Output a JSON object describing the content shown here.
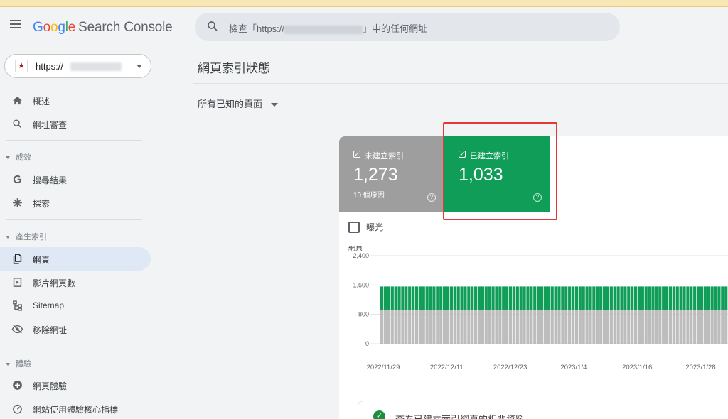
{
  "app": {
    "logo_letters": [
      "G",
      "o",
      "o",
      "g",
      "l",
      "e"
    ],
    "product": "Search Console",
    "search_prefix": "檢查「https://",
    "search_suffix": "」中的任何網址"
  },
  "property": {
    "label": "https://"
  },
  "sidebar": {
    "items_top": [
      {
        "label": "概述",
        "icon": "home-icon"
      },
      {
        "label": "網址審查",
        "icon": "search-icon"
      }
    ],
    "section_performance": "成效",
    "items_performance": [
      {
        "label": "搜尋結果",
        "icon": "google-g-icon"
      },
      {
        "label": "探索",
        "icon": "asterisk-icon"
      }
    ],
    "section_indexing": "產生索引",
    "items_indexing": [
      {
        "label": "網頁",
        "icon": "pages-icon",
        "active": true
      },
      {
        "label": "影片網頁數",
        "icon": "video-page-icon"
      },
      {
        "label": "Sitemap",
        "icon": "sitemap-icon"
      },
      {
        "label": "移除網址",
        "icon": "eye-off-icon"
      }
    ],
    "section_experience": "體驗",
    "items_experience": [
      {
        "label": "網頁體驗",
        "icon": "plus-circle-icon"
      },
      {
        "label": "網站使用體驗核心指標",
        "icon": "gauge-icon"
      }
    ]
  },
  "main": {
    "title": "網頁索引狀態",
    "filter": "所有已知的頁面",
    "tiles": [
      {
        "label": "未建立索引",
        "value": "1,273",
        "sub": "10 個原因",
        "color": "#9e9e9e"
      },
      {
        "label": "已建立索引",
        "value": "1,033",
        "sub": "",
        "color": "#0f9d58"
      }
    ],
    "impressions_label": "曝光",
    "footer_text": "查看已建立索引網頁的相關資料"
  },
  "chart_data": {
    "type": "bar",
    "stacked": true,
    "ylabel": "網頁",
    "yticks": [
      "2,400",
      "1,600",
      "800",
      "0"
    ],
    "ylim": [
      0,
      2400
    ],
    "x_tick_labels": [
      "2022/11/29",
      "2022/12/11",
      "2022/12/23",
      "2023/1/4",
      "2023/1/16",
      "2023/1/28"
    ],
    "series": [
      {
        "name": "未建立索引",
        "color": "#bdbdbd",
        "value_approx": 910
      },
      {
        "name": "已建立索引",
        "color": "#0f9d58",
        "value_approx": 650
      }
    ],
    "grid": true
  }
}
